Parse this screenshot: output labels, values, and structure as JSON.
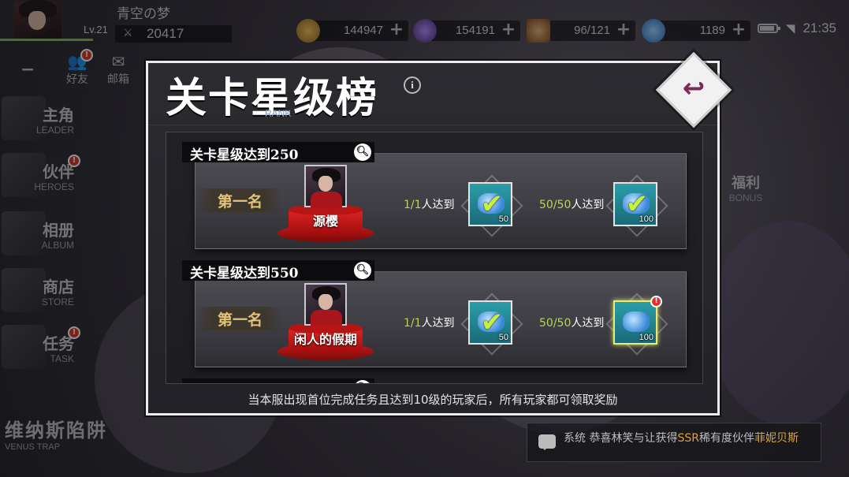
{
  "player": {
    "name": "青空の梦",
    "level": "Lv.21",
    "power": "20417"
  },
  "resources": [
    {
      "name": "gold",
      "value": "144947",
      "color": "#d49a2e"
    },
    {
      "name": "crystal",
      "value": "154191",
      "color": "#8a5bc4"
    },
    {
      "name": "stamina",
      "value": "96/121",
      "color": "#c98a4a"
    },
    {
      "name": "diamond",
      "value": "1189",
      "color": "#3a9ad9"
    }
  ],
  "status_bar": {
    "time": "21:35"
  },
  "top_menu": [
    {
      "label": "好友",
      "icon": "friends-icon"
    },
    {
      "label": "邮箱",
      "icon": "mail-icon"
    }
  ],
  "left_menu": [
    {
      "cn": "主角",
      "en": "LEADER"
    },
    {
      "cn": "伙伴",
      "en": "HEROES"
    },
    {
      "cn": "相册",
      "en": "ALBUM"
    },
    {
      "cn": "商店",
      "en": "STORE"
    },
    {
      "cn": "任务",
      "en": "TASK"
    }
  ],
  "right_menu": {
    "bonus_cn": "福利",
    "bonus_en": "BONUS"
  },
  "venus": {
    "cn": "维纳斯陷阱",
    "en": "VENUS TRAP"
  },
  "chat": {
    "prefix": "系统 恭喜林笑与让获得",
    "rarity": "SSR",
    "middle": "稀有度伙伴",
    "hero": "菲妮贝斯"
  },
  "dialog": {
    "title": "关卡星级榜",
    "subtitle": "RANK",
    "info": "i",
    "footer": "当本服出现首位完成任务且达到10级的玩家后，所有玩家都可领取奖励",
    "cards": [
      {
        "heading": "关卡星级达到250",
        "rank_label": "第一名",
        "player_name": "源樱",
        "cond1_count": "1/1",
        "cond1_text": "人达到",
        "reward1_qty": "50",
        "cond2_count": "50/50",
        "cond2_text": "人达到",
        "reward2_qty": "100"
      },
      {
        "heading": "关卡星级达到550",
        "rank_label": "第一名",
        "player_name": "闲人的假期",
        "cond1_count": "1/1",
        "cond1_text": "人达到",
        "reward1_qty": "50",
        "cond2_count": "50/50",
        "cond2_text": "人达到",
        "reward2_qty": "100"
      }
    ]
  }
}
